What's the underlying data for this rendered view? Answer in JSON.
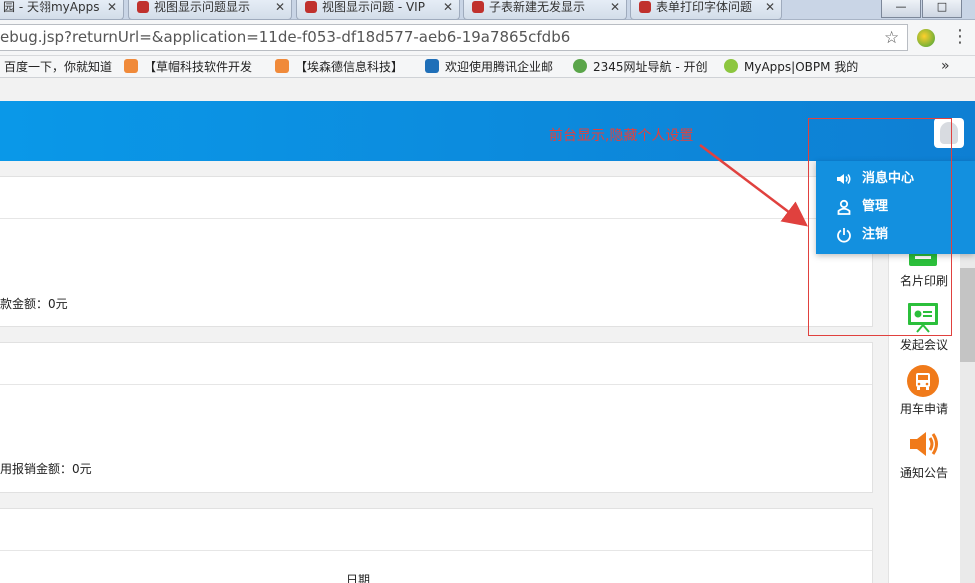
{
  "browser": {
    "tabs": [
      {
        "label": "园 - 天翎myApps"
      },
      {
        "label": "视图显示问题显示"
      },
      {
        "label": "视图显示问题 - VIP"
      },
      {
        "label": "子表新建无发显示"
      },
      {
        "label": "表单打印字体问题"
      }
    ],
    "window_controls": {
      "minimize": "—",
      "restore": "□"
    },
    "address": "ebug.jsp?returnUrl=&application=11de-f053-df18d577-aeb6-19a7865cfdb6",
    "bookmarks": [
      {
        "label": "百度一下，你就知道"
      },
      {
        "label": "【草帽科技软件开发"
      },
      {
        "label": "【埃森德信息科技】"
      },
      {
        "label": "欢迎使用腾讯企业邮"
      },
      {
        "label": "2345网址导航 - 开创"
      },
      {
        "label": "MyApps|OBPM 我的"
      }
    ],
    "more": "»"
  },
  "content": {
    "card1_text": "款金额：0元",
    "card2_text": "用报销金额：0元",
    "card3_header": "日期"
  },
  "menu": {
    "items": [
      {
        "label": "消息中心",
        "icon": "speaker-icon"
      },
      {
        "label": "管理",
        "icon": "user-icon"
      },
      {
        "label": "注销",
        "icon": "power-icon"
      }
    ]
  },
  "apps": [
    {
      "label": "名片印刷",
      "icon": "card-print-icon"
    },
    {
      "label": "发起会议",
      "icon": "meeting-board-icon"
    },
    {
      "label": "用车申请",
      "icon": "bus-icon"
    },
    {
      "label": "通知公告",
      "icon": "speaker-icon"
    }
  ],
  "annotation": {
    "text": "前台显示,隐藏个人设置"
  },
  "colors": {
    "header_blue": "#0e8be0",
    "menu_blue": "#1390df",
    "annotation_red": "#e0413e"
  }
}
